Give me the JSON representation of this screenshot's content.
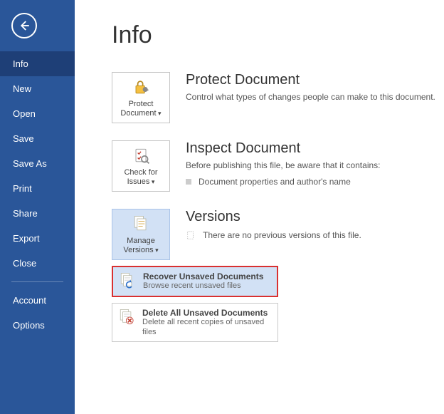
{
  "sidebar": {
    "items": [
      {
        "label": "Info"
      },
      {
        "label": "New"
      },
      {
        "label": "Open"
      },
      {
        "label": "Save"
      },
      {
        "label": "Save As"
      },
      {
        "label": "Print"
      },
      {
        "label": "Share"
      },
      {
        "label": "Export"
      },
      {
        "label": "Close"
      }
    ],
    "footer": [
      {
        "label": "Account"
      },
      {
        "label": "Options"
      }
    ]
  },
  "page_title": "Info",
  "sections": {
    "protect": {
      "tile_line1": "Protect",
      "tile_line2": "Document",
      "title": "Protect Document",
      "desc": "Control what types of changes people can make to this document."
    },
    "inspect": {
      "tile_line1": "Check for",
      "tile_line2": "Issues",
      "title": "Inspect Document",
      "desc": "Before publishing this file, be aware that it contains:",
      "bullet": "Document properties and author's name"
    },
    "versions": {
      "tile_line1": "Manage",
      "tile_line2": "Versions",
      "title": "Versions",
      "desc": "There are no previous versions of this file."
    }
  },
  "menu": {
    "recover": {
      "title": "Recover Unsaved Documents",
      "desc": "Browse recent unsaved files"
    },
    "delete": {
      "title": "Delete All Unsaved Documents",
      "desc": "Delete all recent copies of unsaved files"
    }
  }
}
